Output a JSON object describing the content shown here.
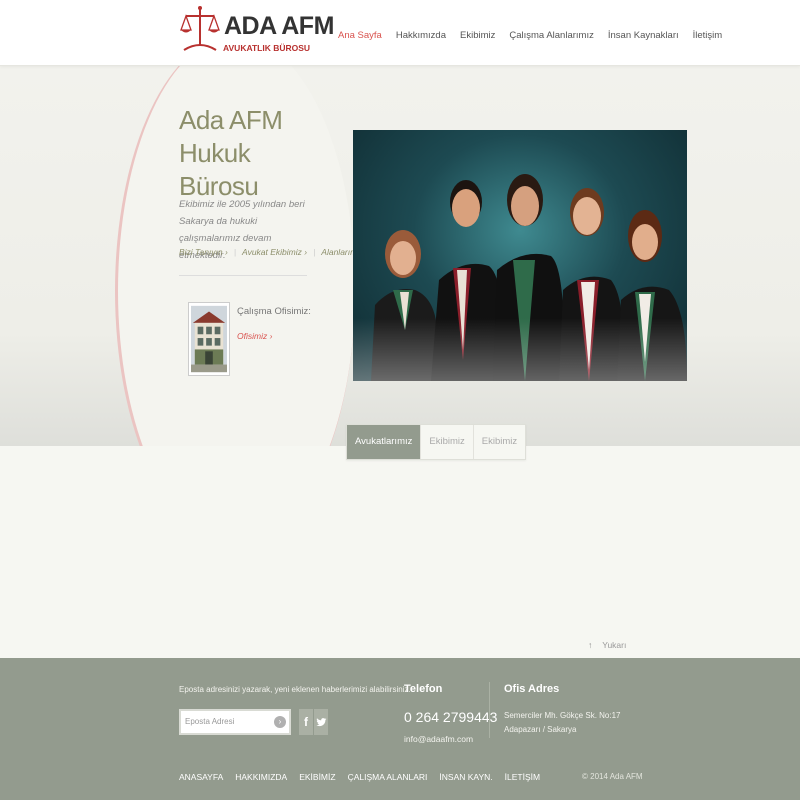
{
  "header": {
    "logo": {
      "brand": "ADA AFM",
      "subtitle": "AVUKATLIK BÜROSU"
    },
    "nav": [
      "Ana Sayfa",
      "Hakkımızda",
      "Ekibimiz",
      "Çalışma Alanlarımız",
      "İnsan Kaynakları",
      "İletişim"
    ],
    "active_index": 0
  },
  "hero": {
    "title": "Ada AFM Hukuk Bürosu",
    "description": "Ekibimiz ile 2005 yılından beri Sakarya da hukuki çalışmalarımız devam etmektedir.",
    "links": [
      "Bizi Tanıyın ›",
      "Avukat Ekibimiz ›",
      "Alanlarımız ›"
    ],
    "office": {
      "title": "Çalışma Ofisimiz:",
      "link": "Ofisimiz ›"
    }
  },
  "tabs": [
    "Avukatlarımız",
    "Ekibimiz",
    "Ekibimiz"
  ],
  "back_to_top": "Yukarı",
  "footer": {
    "newsletter_text": "Eposta adresinizi yazarak, yeni eklenen haberlerimizi alabilirsiniz.",
    "email_placeholder": "Eposta Adresi",
    "phone_label": "Telefon",
    "phone": "0 264 2799443",
    "email": "info@adaafm.com",
    "address_label": "Ofis Adres",
    "address": "Semerciler Mh. Gökçe Sk. No:17 Adapazarı / Sakarya",
    "nav": [
      "ANASAYFA",
      "HAKKIMIZDA",
      "EKİBİMİZ",
      "ÇALIŞMA ALANLARI",
      "İNSAN KAYN.",
      "İLETİŞİM"
    ],
    "copyright": "© 2014 Ada AFM"
  },
  "colors": {
    "accent_red": "#d9534f",
    "title_olive": "#8c8e6a",
    "footer_bg": "#939b8e",
    "page_bg": "#f6f7f2"
  },
  "icons": [
    "scales-of-justice-logo",
    "facebook-icon",
    "twitter-icon",
    "search-arrow-icon",
    "up-arrow-icon"
  ]
}
